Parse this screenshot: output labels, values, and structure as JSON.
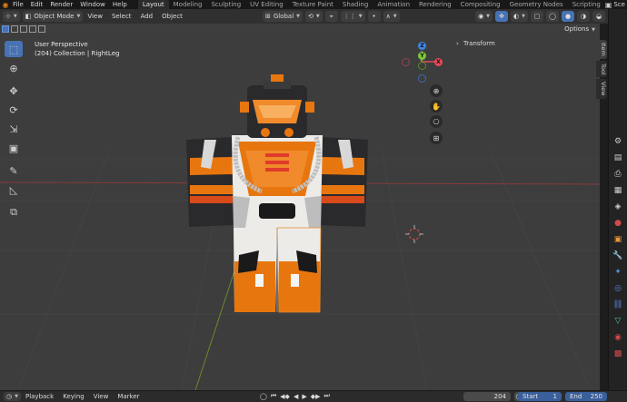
{
  "menubar": {
    "items": [
      "File",
      "Edit",
      "Render",
      "Window",
      "Help"
    ],
    "workspaces": [
      "Layout",
      "Modeling",
      "Sculpting",
      "UV Editing",
      "Texture Paint",
      "Shading",
      "Animation",
      "Rendering",
      "Compositing",
      "Geometry Nodes",
      "Scripting"
    ],
    "active_workspace": "Layout",
    "scene_label": "Sce"
  },
  "header": {
    "mode": "Object Mode",
    "menus": [
      "View",
      "Select",
      "Add",
      "Object"
    ],
    "transform_orientation": "Global"
  },
  "options_label": "Options",
  "viewport": {
    "perspective_label": "User Perspective",
    "collection_label": "(204) Collection | RightLeg",
    "transform_panel": "Transform",
    "gizmo": {
      "z": "Z",
      "y": "Y",
      "x": "X"
    }
  },
  "sidebar_tabs": [
    "Item",
    "Tool",
    "View"
  ],
  "timeline": {
    "menus": [
      "Playback",
      "Keying",
      "View",
      "Marker"
    ],
    "current_frame": "204",
    "start_label": "Start",
    "start_value": "1",
    "end_label": "End",
    "end_value": "250"
  },
  "colors": {
    "accent": "#4772b3",
    "orange": "#e8760f",
    "x_axis": "#e24a5a",
    "y_axis": "#7cc43a",
    "z_axis": "#3f84e6"
  }
}
